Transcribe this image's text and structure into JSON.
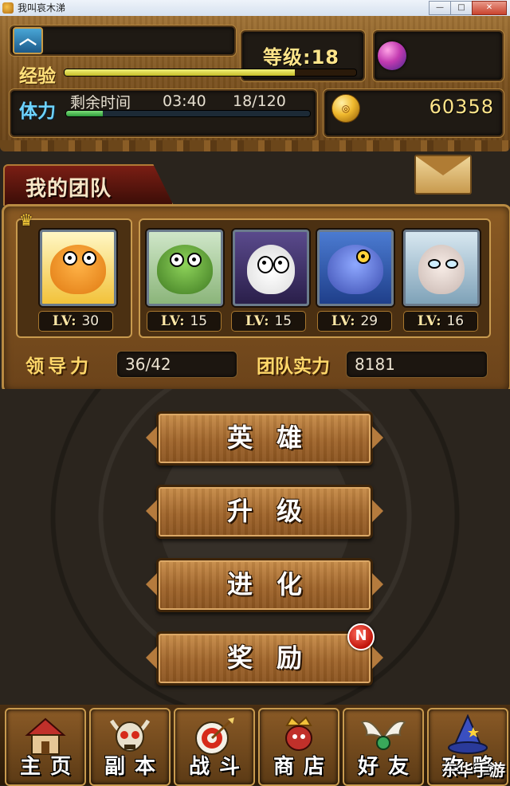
{
  "window": {
    "title": "我叫哀木涕"
  },
  "status": {
    "level_label": "等级:",
    "level": "18",
    "exp_label": "经验",
    "exp_fraction": 0.79,
    "stamina_label": "体力",
    "stamina_timer_label": "剩余时间",
    "stamina_timer": "03:40",
    "stamina_count": "18/120",
    "stamina_fraction": 0.15,
    "gold": "60358"
  },
  "team": {
    "title": "我的团队",
    "leader": {
      "level_prefix": "LV:",
      "level": "30",
      "portrait": "orange-dog-hero"
    },
    "members": [
      {
        "level_prefix": "LV:",
        "level": "15",
        "portrait": "green-orc-hero"
      },
      {
        "level_prefix": "LV:",
        "level": "15",
        "portrait": "skull-boy-hero"
      },
      {
        "level_prefix": "LV:",
        "level": "29",
        "portrait": "blue-murloc-hero"
      },
      {
        "level_prefix": "LV:",
        "level": "16",
        "portrait": "silver-hair-elf-hero"
      }
    ],
    "leadership_label": "领导力",
    "leadership_value": "36/42",
    "team_power_label": "团队实力",
    "team_power_value": "8181"
  },
  "menu": {
    "heroes": "英雄",
    "upgrade": "升级",
    "evolve": "进化",
    "rewards": "奖励",
    "new_badge": "N"
  },
  "nav": [
    {
      "label": "主页",
      "icon": "house-icon"
    },
    {
      "label": "副本",
      "icon": "skull-icon"
    },
    {
      "label": "战斗",
      "icon": "target-arrow-icon"
    },
    {
      "label": "商店",
      "icon": "merchant-icon"
    },
    {
      "label": "好友",
      "icon": "wings-icon"
    },
    {
      "label": "攻略",
      "icon": "wizard-hat-icon"
    }
  ],
  "watermark": "东华手游",
  "colors": {
    "gold_text": "#ffe58a",
    "stamina_blue": "#6fd4ff",
    "exp_yellow": "#ffe07a",
    "panel_brown": "#7b521f"
  }
}
